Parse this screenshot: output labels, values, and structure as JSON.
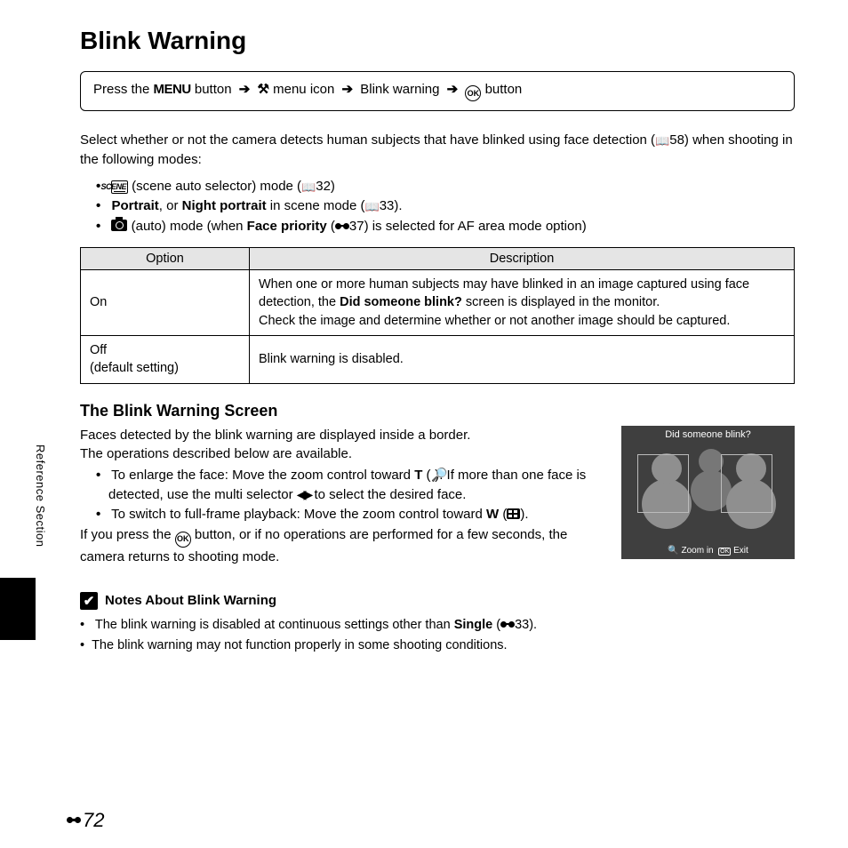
{
  "title": "Blink Warning",
  "sideTab": "Reference Section",
  "nav": {
    "prefix": "Press the ",
    "menuBtn": "MENU",
    "seg1": " button ",
    "seg2": " menu icon ",
    "seg3": " Blink warning ",
    "seg4": " button"
  },
  "intro": {
    "line1a": "Select whether or not the camera detects human subjects that have blinked using face detection (",
    "line1ref": "58",
    "line1b": ") when shooting in the following modes:"
  },
  "bullets": {
    "b1a": " (scene auto selector) mode (",
    "b1ref": "32",
    "b1b": ")",
    "b2a": "Portrait",
    "b2b": ", or ",
    "b2c": "Night portrait",
    "b2d": " in scene mode (",
    "b2ref": "33",
    "b2e": ").",
    "b3a": " (auto) mode (when ",
    "b3b": "Face priority",
    "b3c": " (",
    "b3ref": "37",
    "b3d": ") is selected for AF area mode option)"
  },
  "table": {
    "h1": "Option",
    "h2": "Description",
    "r1opt": "On",
    "r1a": "When one or more human subjects may have blinked in an image captured using face detection, the ",
    "r1b": "Did someone blink?",
    "r1c": " screen is displayed in the monitor.",
    "r1d": "Check the image and determine whether or not another image should be captured.",
    "r2opt1": "Off",
    "r2opt2": "(default setting)",
    "r2desc": "Blink warning is disabled."
  },
  "screen": {
    "heading": "The Blink Warning Screen",
    "p1": "Faces detected by the blink warning are displayed inside a border.",
    "p2": "The operations described below are available.",
    "li1a": "To enlarge the face: Move the zoom control toward ",
    "li1T": "T",
    "li1b": " (",
    "li1c": "). If more than one face is detected, use the multi selector ",
    "li1d": " to select the desired face.",
    "li2a": "To switch to full-frame playback: Move the zoom control toward ",
    "li2W": "W",
    "li2b": " (",
    "li2c": ").",
    "p3a": "If you press the ",
    "p3b": " button, or if no operations are performed for a few seconds, the camera returns to shooting mode."
  },
  "lcd": {
    "title": "Did someone blink?",
    "zoom": "Zoom in",
    "exit": "Exit",
    "ok": "OK"
  },
  "notes": {
    "heading": "Notes About Blink Warning",
    "n1a": "The blink warning is disabled at continuous settings other than ",
    "n1b": "Single",
    "n1c": " (",
    "n1ref": "33",
    "n1d": ").",
    "n2": "The blink warning may not function properly in some shooting conditions."
  },
  "pageNumber": "72"
}
